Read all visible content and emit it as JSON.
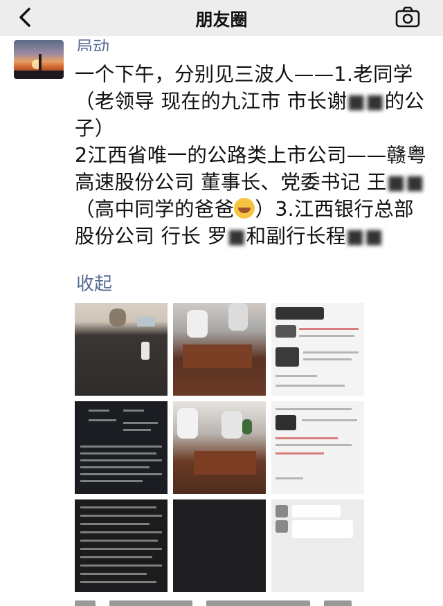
{
  "header": {
    "title": "朋友圈"
  },
  "post": {
    "username": "局动",
    "content": {
      "line1_a": "一个下午，分别见三波人——1.老同学（老领导 现在的九江市 市长谢",
      "line1_blur": "■■",
      "line1_b": "的公子）",
      "line2_a": "2江西省唯一的公路类上市公司——赣粤高速股份公司 董事长、党委书记 王",
      "line2_blur": "■■",
      "line2_b": "（高中同学的爸爸",
      "line2_c": "）3.江西银行总部股份公司 行长 罗",
      "line2_blur2": "■",
      "line2_d": "和副行长程",
      "line2_blur3": "■■"
    },
    "collapse_label": "收起",
    "images": [
      "meeting-table-photo",
      "sofa-meeting-photo",
      "news-screenshot",
      "bio-document-dark",
      "sofa-meeting-photo-2",
      "news-screenshot-2",
      "bio-document-dark-2",
      "dark-image",
      "chat-screenshot"
    ]
  },
  "colors": {
    "header_bg": "#ededed",
    "name_link": "#576b95",
    "text": "#111111"
  }
}
